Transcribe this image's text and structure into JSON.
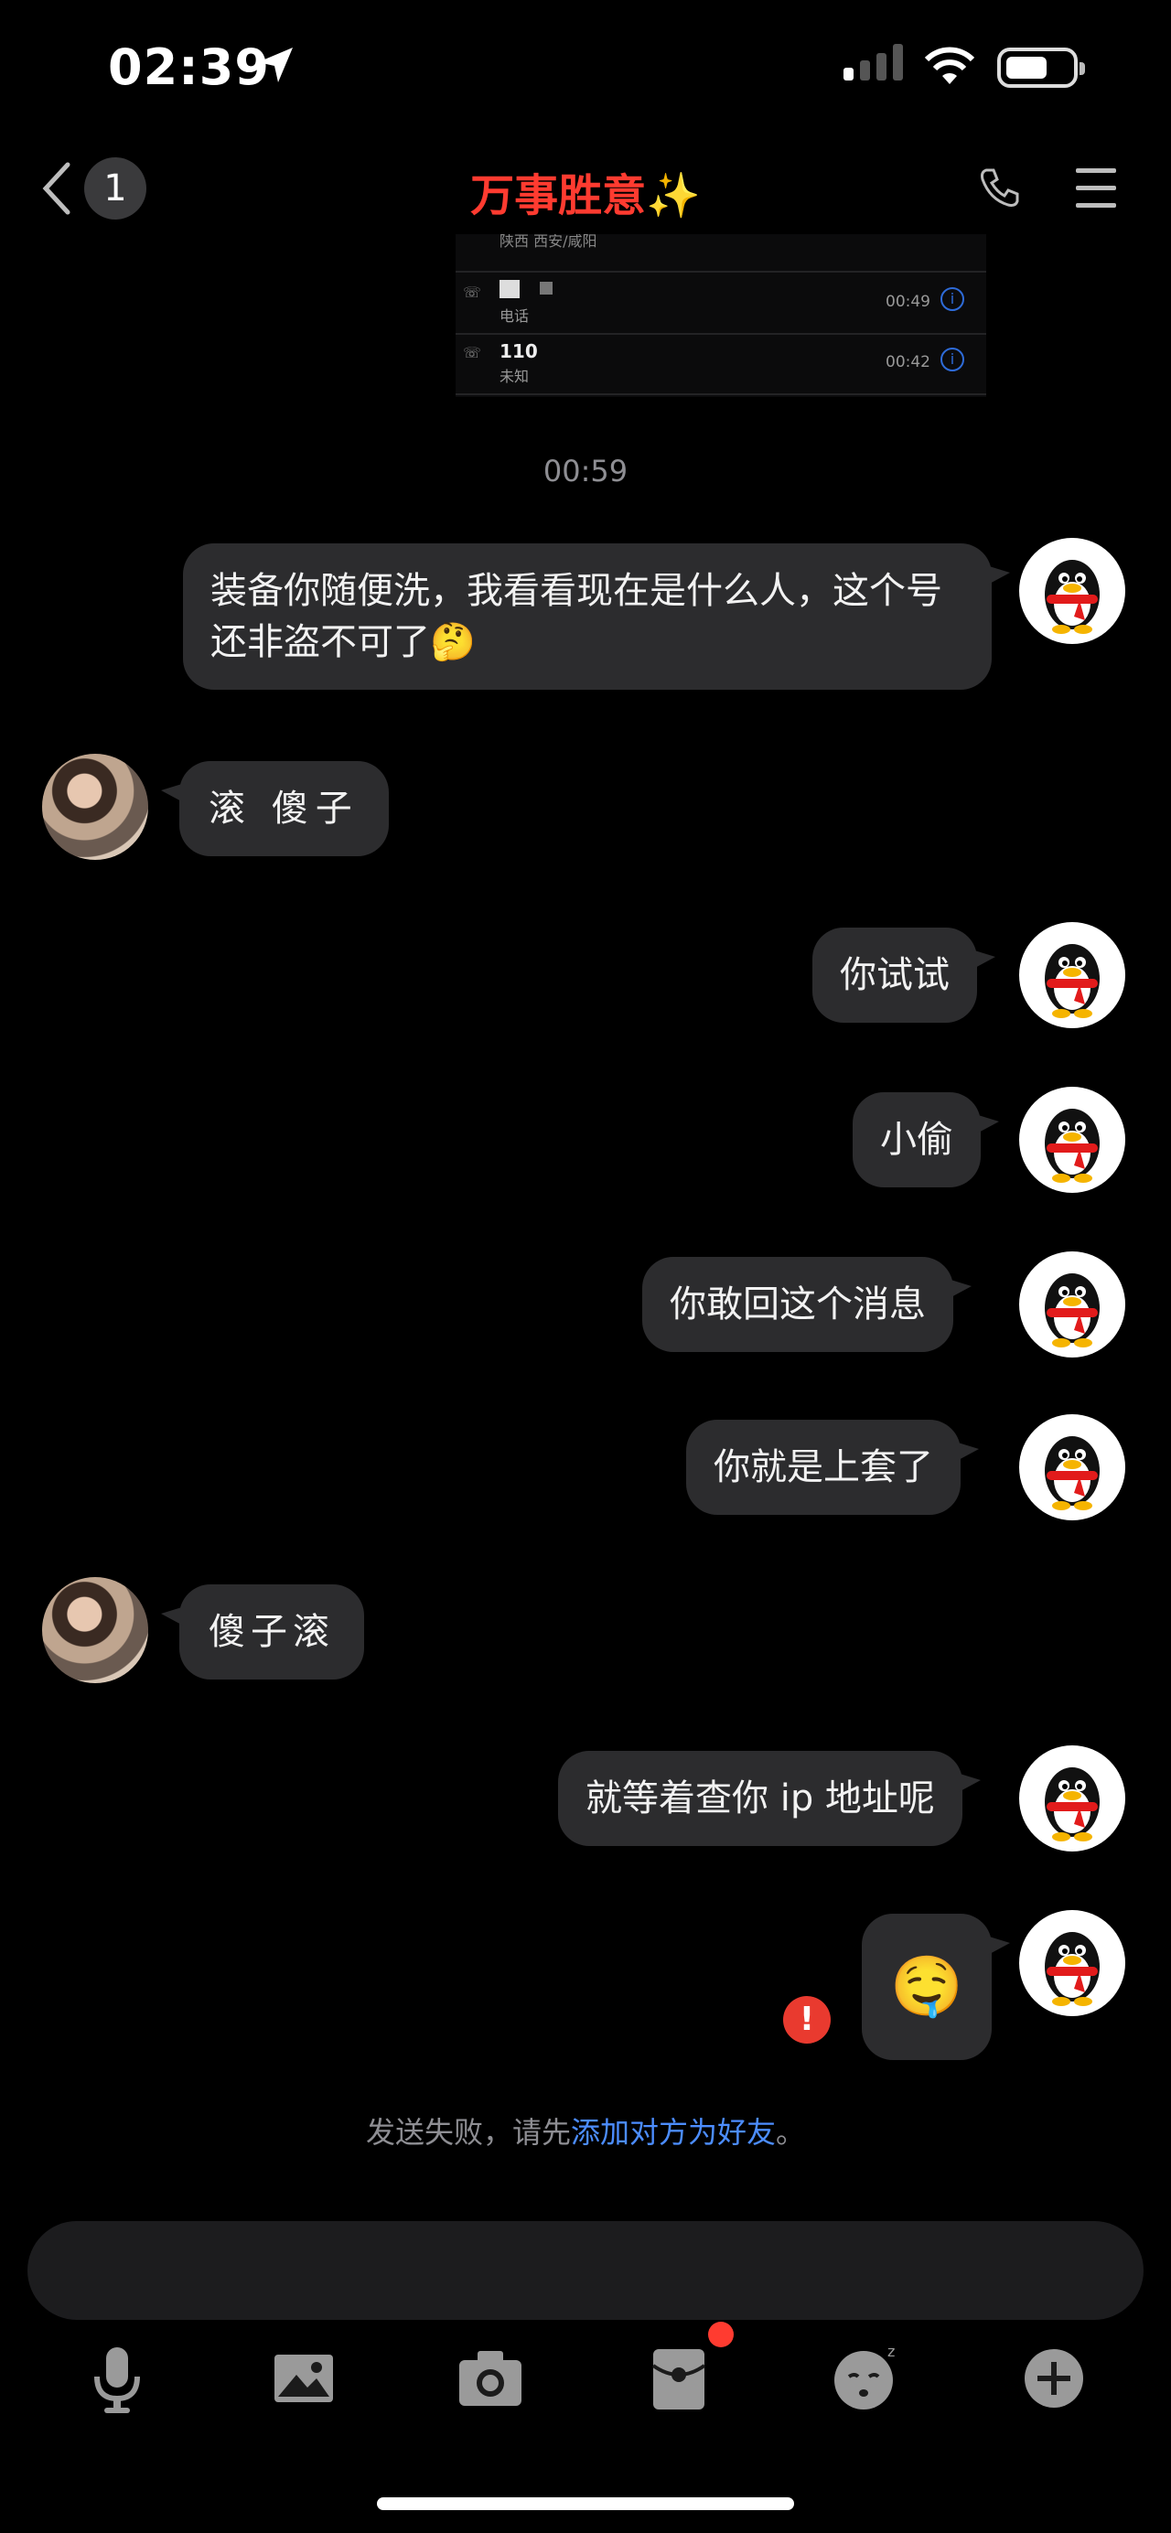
{
  "status_bar": {
    "time": "02:39"
  },
  "nav": {
    "back_count": "1",
    "title": "万事胜意✨"
  },
  "screenshot_fragment": {
    "partial_text": "陕西 西安/咸阳",
    "rows": [
      {
        "name": "",
        "sub": "电话",
        "time": "00:49"
      },
      {
        "name": "110",
        "sub": "未知",
        "time": "00:42"
      }
    ]
  },
  "timestamp": "00:59",
  "messages": [
    {
      "dir": "out",
      "text": "装备你随便洗，我看看现在是什么人，这个号还非盗不可了🤔"
    },
    {
      "dir": "in",
      "text": "滚 傻子"
    },
    {
      "dir": "out",
      "text": "你试试"
    },
    {
      "dir": "out",
      "text": "小偷"
    },
    {
      "dir": "out",
      "text": "你敢回这个消息"
    },
    {
      "dir": "out",
      "text": "你就是上套了"
    },
    {
      "dir": "in",
      "text": "傻子滚"
    },
    {
      "dir": "out",
      "text": "就等着查你 ip 地址呢"
    },
    {
      "dir": "out",
      "text": "🤤",
      "failed": true
    }
  ],
  "failure_notice": {
    "prefix": "发送失败，请先",
    "link": "添加对方为好友",
    "suffix": "。"
  },
  "input": {
    "placeholder": ""
  },
  "toolbar": [
    "microphone-icon",
    "image-icon",
    "camera-icon",
    "red-packet-icon",
    "emoji-icon",
    "plus-icon"
  ],
  "colors": {
    "title": "#ff3b30",
    "bubble": "#2c2c2e",
    "link": "#4c8dff",
    "error": "#e93a2f"
  }
}
